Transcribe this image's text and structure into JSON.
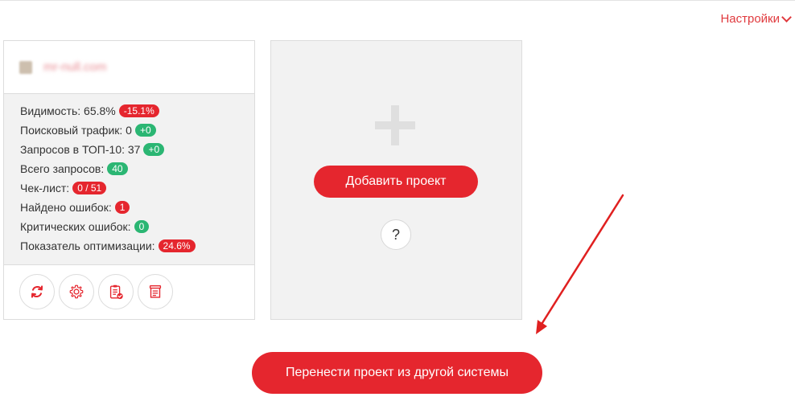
{
  "header": {
    "settings_label": "Настройки"
  },
  "project": {
    "domain": "mr-null.com",
    "stats": [
      {
        "label": "Видимость: 65.8%",
        "badge": "-15.1%",
        "badge_color": "red"
      },
      {
        "label": "Поисковый трафик: 0",
        "badge": "+0",
        "badge_color": "green"
      },
      {
        "label": "Запросов в ТОП-10: 37",
        "badge": "+0",
        "badge_color": "green"
      },
      {
        "label": "Всего запросов:",
        "badge": "40",
        "badge_color": "green"
      },
      {
        "label": "Чек-лист:",
        "badge": "0 / 51",
        "badge_color": "red"
      },
      {
        "label": "Найдено ошибок:",
        "badge": "1",
        "badge_color": "red"
      },
      {
        "label": "Критических ошибок:",
        "badge": "0",
        "badge_color": "green"
      },
      {
        "label": "Показатель оптимизации:",
        "badge": "24.6%",
        "badge_color": "red"
      }
    ],
    "actions": [
      "refresh-icon",
      "gear-icon",
      "checklist-icon",
      "report-icon"
    ]
  },
  "add_project": {
    "button_label": "Добавить проект",
    "help_label": "?"
  },
  "transfer": {
    "button_label": "Перенести проект из другой системы"
  },
  "colors": {
    "accent": "#e5262e",
    "success": "#2bb673",
    "panel": "#f2f2f2"
  }
}
